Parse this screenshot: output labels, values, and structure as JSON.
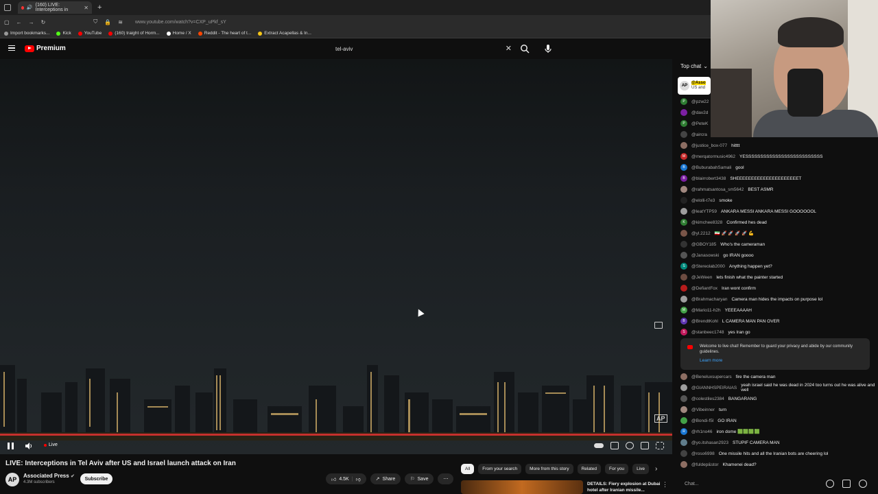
{
  "browser": {
    "tab_title": "(160) LIVE: Interceptions in",
    "url": "www.youtube.com/watch?v=CXP_uPkf_sY",
    "bookmarks": [
      {
        "label": "Import bookmarks...",
        "color": "#999999"
      },
      {
        "label": "Kick",
        "color": "#53fc18"
      },
      {
        "label": "YouTube",
        "color": "#ff0000"
      },
      {
        "label": "(160) traight of Horm...",
        "color": "#ff0000"
      },
      {
        "label": "Home / X",
        "color": "#ffffff"
      },
      {
        "label": "Reddit - The heart of t...",
        "color": "#ff4500"
      },
      {
        "label": "Extract Acapellas & In...",
        "color": "#f5c518"
      }
    ]
  },
  "youtube": {
    "logo_text": "Premium",
    "search_value": "tel-aviv"
  },
  "player": {
    "live_label": "Live",
    "watermark": "AP"
  },
  "video": {
    "title": "LIVE: Interceptions in Tel Aviv after US and Israel launch attack on Iran",
    "channel": "Associated Press",
    "avatar_text": "AP",
    "subscribers": "4.3M subscribers",
    "subscribe_label": "Subscribe",
    "likes": "4.5K",
    "share_label": "Share",
    "save_label": "Save"
  },
  "chips": [
    "All",
    "From your search",
    "More from this story",
    "Related",
    "For you",
    "Live"
  ],
  "recommended": {
    "title": "DETAILS: Fiery explosion at Dubai hotel after Iranian missile..."
  },
  "chat": {
    "header": "Top chat",
    "pinned_avatar": "AP",
    "pinned_user": "@Asso",
    "pinned_text": "US and",
    "messages": [
      {
        "av": "P",
        "color": "#2e7d32",
        "user": "@pzw22",
        "text": ""
      },
      {
        "av": "",
        "color": "#7b1fa2",
        "user": "@dav2d",
        "text": ""
      },
      {
        "av": "P",
        "color": "#2e7d32",
        "user": "@PeteK",
        "text": ""
      },
      {
        "av": "",
        "color": "#444444",
        "user": "@aircra",
        "text": ""
      },
      {
        "av": "",
        "color": "#8d6e63",
        "user": "@justice_box-077",
        "text": "hitttt"
      },
      {
        "av": "M",
        "color": "#c62828",
        "user": "@merqatormusic4962",
        "text": "YESSSSSSSSSSSSSSSSSSSSSSSSSS"
      },
      {
        "av": "B",
        "color": "#1976d2",
        "user": "@BuburabahSamali",
        "text": "gool"
      },
      {
        "av": "B",
        "color": "#7b1fa2",
        "user": "@blairrobert3438",
        "text": "SHEEEEEEEEEEEEEEEEEEEEET"
      },
      {
        "av": "",
        "color": "#a1887f",
        "user": "@rahmatsantosa_sm5642",
        "text": "BEST ASMR"
      },
      {
        "av": "",
        "color": "#222222",
        "user": "@elolli-t7e3",
        "text": "smoke"
      },
      {
        "av": "",
        "color": "#9e9e9e",
        "user": "@leatYTP59",
        "text": "ANKARA MESSI ANKARA MESSI GOOOOOOL"
      },
      {
        "av": "K",
        "color": "#2e7d32",
        "user": "@kimchee8328",
        "text": "Confirmed hes dead"
      },
      {
        "av": "",
        "color": "#795548",
        "user": "@yl.2212",
        "text": "🇮🇷 🚀 🚀 🚀 🚀 💪"
      },
      {
        "av": "",
        "color": "#333333",
        "user": "@GBOY185",
        "text": "Who's the cameraman"
      },
      {
        "av": "",
        "color": "#555555",
        "user": "@Janasowski",
        "text": "go IRAN goooo"
      },
      {
        "av": "S",
        "color": "#00897b",
        "user": "@Stereolab2000",
        "text": "Anything happen yet?"
      },
      {
        "av": "",
        "color": "#6d4c41",
        "user": "@JeWeen",
        "text": "lets finish what the painter started"
      },
      {
        "av": "",
        "color": "#b71c1c",
        "user": "@DefiantFox",
        "text": "Iran wont confirm"
      },
      {
        "av": "",
        "color": "#9e9e9e",
        "user": "@Brahmacharyan",
        "text": "Camera man hides the impacts on purpose lol"
      },
      {
        "av": "M",
        "color": "#43a047",
        "user": "@Mario11-h2h",
        "text": "YEEEAAAAH"
      },
      {
        "av": "B",
        "color": "#5e35b1",
        "user": "@BrendtKohl",
        "text": "L CAMERA MAN PAN OVER"
      },
      {
        "av": "S",
        "color": "#c2185b",
        "user": "@stanbeec1748",
        "text": "yes Iran go"
      }
    ],
    "welcome_text": "Welcome to live chat! Remember to guard your privacy and abide by our community guidelines.",
    "learn_more": "Learn more",
    "messages2": [
      {
        "av": "",
        "color": "#8d6e63",
        "user": "@Beneluxsupercars",
        "text": "fire the camera man"
      },
      {
        "av": "",
        "color": "#9e9e9e",
        "user": "@GIANNHSPEIRAIAS",
        "text": "yeah israel said he was dead in 2024 too turns out he was alive and well"
      },
      {
        "av": "",
        "color": "#555555",
        "user": "@colestiles2384",
        "text": "BANGARANG"
      },
      {
        "av": "",
        "color": "#a1887f",
        "user": "@Vibeinner",
        "text": "turn"
      },
      {
        "av": "",
        "color": "#43a047",
        "user": "@Bondi-f5l",
        "text": "GO IRAN"
      },
      {
        "av": "R",
        "color": "#1976d2",
        "user": "@rh1no46",
        "text": "iron dome 🟩🟩🟩🟩"
      },
      {
        "av": "",
        "color": "#607d8b",
        "user": "@yo.itshasan2923",
        "text": "STUPIF CAMERA MAN"
      },
      {
        "av": "",
        "color": "#424242",
        "user": "@roso6998",
        "text": "One missile hits and all the Iranian bots are cheering lol"
      },
      {
        "av": "",
        "color": "#8d6e63",
        "user": "@fuldep&stor",
        "text": "Khamenei dead?"
      }
    ],
    "input_placeholder": "Chat..."
  }
}
